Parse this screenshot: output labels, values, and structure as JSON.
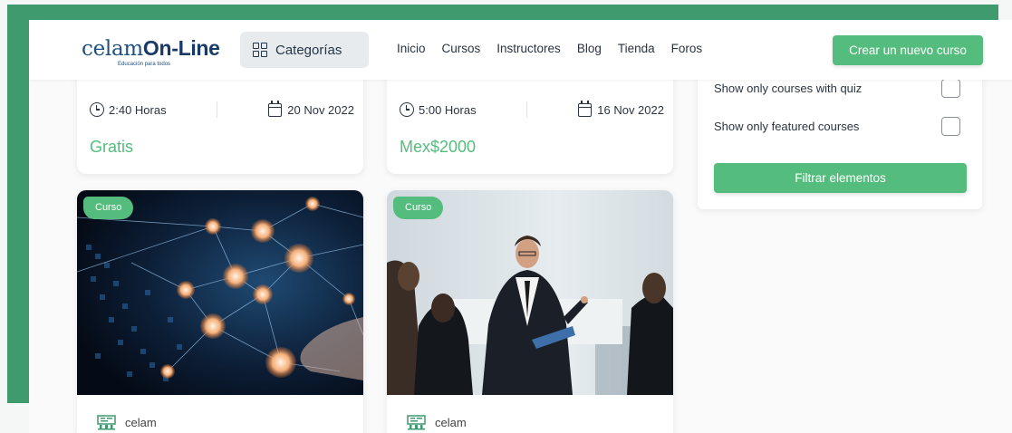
{
  "header": {
    "logo_main": "celam",
    "logo_online": "On-Line",
    "logo_tagline": "Educación para todos",
    "categories_label": "Categorías",
    "nav": [
      "Inicio",
      "Cursos",
      "Instructores",
      "Blog",
      "Tienda",
      "Foros"
    ],
    "cta_label": "Crear un nuevo curso"
  },
  "top_cards": [
    {
      "duration": "2:40 Horas",
      "date": "20 Nov 2022",
      "price": "Gratis"
    },
    {
      "duration": "5:00 Horas",
      "date": "16 Nov 2022",
      "price": "Mex$2000"
    }
  ],
  "image_cards": [
    {
      "badge": "Curso",
      "author": "celam",
      "image": "network-people-icons"
    },
    {
      "badge": "Curso",
      "author": "celam",
      "image": "business-presentation"
    }
  ],
  "filter": {
    "options": [
      {
        "label": "Show only courses with quiz",
        "checked": false
      },
      {
        "label": "Show only featured courses",
        "checked": false
      }
    ],
    "button_label": "Filtrar elementos"
  },
  "colors": {
    "accent": "#54bd7d",
    "frame": "#3f9a6e",
    "brand": "#1f4f7d"
  }
}
